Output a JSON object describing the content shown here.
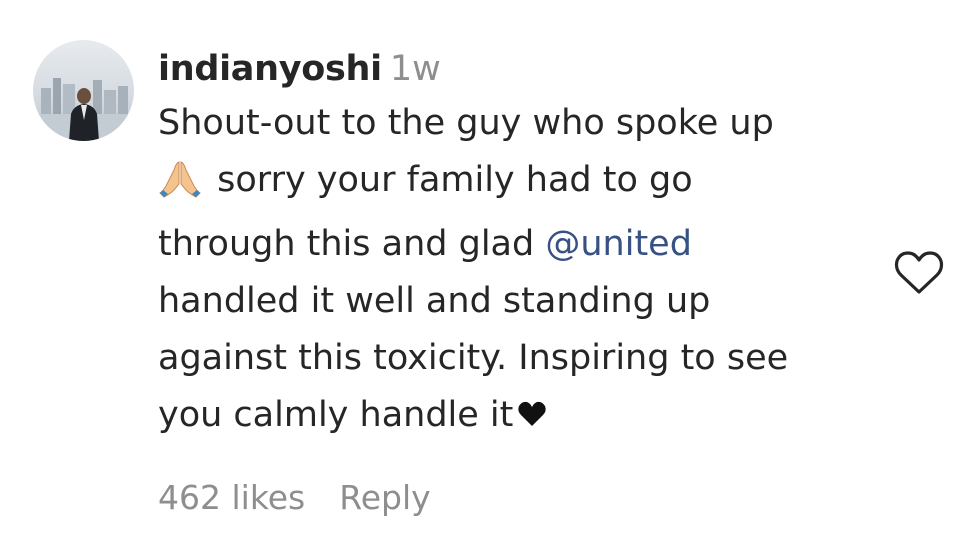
{
  "comment": {
    "username": "indianyoshi",
    "timestamp": "1w",
    "text_lines": [
      "Shout-out to the guy who spoke up",
      "sorry your family had to go",
      "through this and glad",
      "@united",
      "handled it well and standing up",
      "against this toxicity. Inspiring to see",
      "you calmly handle it"
    ],
    "emoji": "folded-hands-icon",
    "trailing_icon": "black-heart-icon",
    "likes": "462 likes",
    "reply_label": "Reply",
    "like_icon": "heart-outline-icon"
  },
  "colors": {
    "text": "#262626",
    "muted": "#8e8e8e",
    "mention": "#385185"
  }
}
